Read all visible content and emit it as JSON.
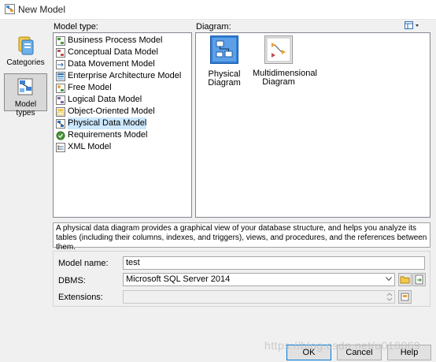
{
  "window": {
    "title": "New Model"
  },
  "sidebar": {
    "items": [
      {
        "label": "Categories",
        "active": false
      },
      {
        "label": "Model types",
        "active": true
      }
    ]
  },
  "model_type": {
    "heading": "Model type:",
    "items": [
      {
        "label": "Business Process Model",
        "icon": "business-process-icon"
      },
      {
        "label": "Conceptual Data Model",
        "icon": "conceptual-data-icon"
      },
      {
        "label": "Data Movement Model",
        "icon": "data-movement-icon"
      },
      {
        "label": "Enterprise Architecture Model",
        "icon": "enterprise-architecture-icon"
      },
      {
        "label": "Free Model",
        "icon": "free-model-icon"
      },
      {
        "label": "Logical Data Model",
        "icon": "logical-data-icon"
      },
      {
        "label": "Object-Oriented Model",
        "icon": "object-oriented-icon"
      },
      {
        "label": "Physical Data Model",
        "icon": "physical-data-icon",
        "selected": true
      },
      {
        "label": "Requirements Model",
        "icon": "requirements-icon"
      },
      {
        "label": "XML Model",
        "icon": "xml-model-icon"
      }
    ]
  },
  "diagram": {
    "heading": "Diagram:",
    "items": [
      {
        "label": "Physical Diagram",
        "selected": true
      },
      {
        "label": "Multidimensional Diagram"
      }
    ]
  },
  "description": "A physical data diagram provides a graphical view of your database structure, and helps you analyze its tables (including their columns, indexes, and triggers), views, and procedures, and the references between them.",
  "form": {
    "model_name_label": "Model name:",
    "model_name_value": "test",
    "dbms_label": "DBMS:",
    "dbms_value": "Microsoft SQL Server 2014",
    "extensions_label": "Extensions:",
    "extensions_value": ""
  },
  "buttons": {
    "ok": "OK",
    "cancel": "Cancel",
    "help": "Help"
  },
  "watermark": "https://blog.csdn.net/u010069",
  "colors": {
    "selection": "#cde8ff",
    "accent": "#0078d7"
  }
}
